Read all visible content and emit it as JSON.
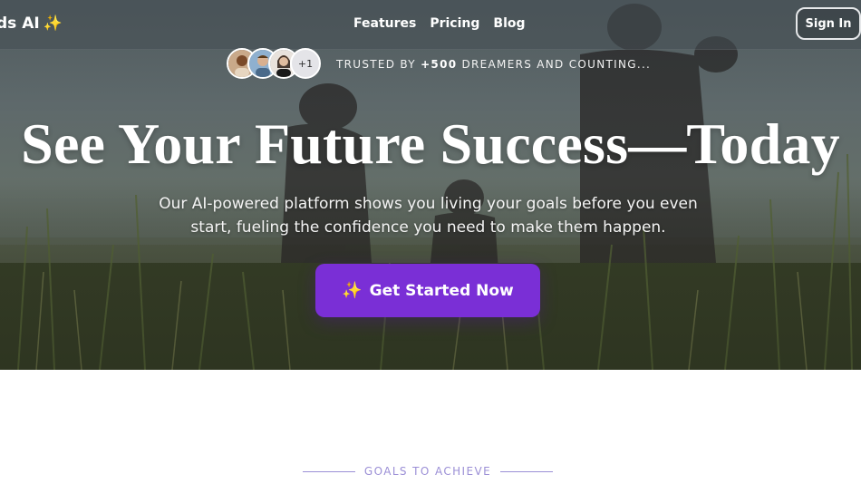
{
  "nav": {
    "brand": "ds AI",
    "brand_icon": "sparkles-icon",
    "links": [
      "Features",
      "Pricing",
      "Blog"
    ],
    "signin_label": "Sign In"
  },
  "hero": {
    "avatars_more": "+1",
    "trusted_prefix": "TRUSTED BY ",
    "trusted_count": "+500",
    "trusted_suffix": " DREAMERS AND COUNTING...",
    "headline": "See Your Future Success—Today",
    "subtitle_line1": "Our AI-powered platform shows you living your goals before you even",
    "subtitle_line2": "start, fueling the confidence you need to make them happen.",
    "cta_label": "Get Started Now",
    "cta_icon": "sparkles-icon"
  },
  "section": {
    "label": "GOALS TO ACHIEVE"
  },
  "colors": {
    "accent": "#7a2fd6",
    "spark": "#f5c518",
    "section_label": "#9b8fd6"
  }
}
